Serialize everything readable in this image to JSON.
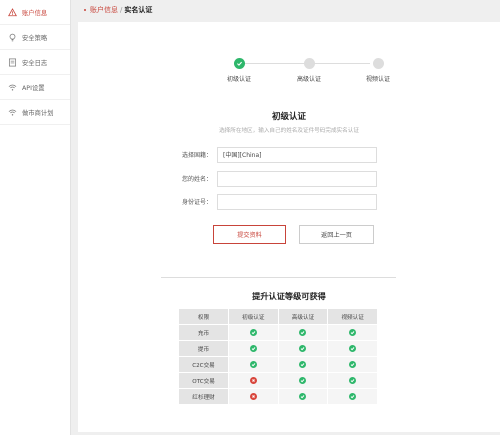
{
  "sidebar": {
    "items": [
      {
        "label": "账户信息",
        "icon": "warning-icon",
        "active": true
      },
      {
        "label": "安全策略",
        "icon": "bulb-icon",
        "active": false
      },
      {
        "label": "安全日志",
        "icon": "document-icon",
        "active": false
      },
      {
        "label": "API设置",
        "icon": "wifi-icon",
        "active": false
      },
      {
        "label": "做市商计划",
        "icon": "wifi-icon",
        "active": false
      }
    ]
  },
  "breadcrumb": {
    "parent": "账户信息",
    "separator": "/",
    "current": "实名认证"
  },
  "steps": [
    {
      "label": "初级认证",
      "done": true
    },
    {
      "label": "高级认证",
      "done": false
    },
    {
      "label": "视频认证",
      "done": false
    }
  ],
  "form": {
    "title": "初级认证",
    "subtitle": "选择所在地区，输入自己的姓名及证件号码完成实名认证",
    "fields": [
      {
        "label": "选择国籍：",
        "value": "[中国][China]"
      },
      {
        "label": "您的姓名：",
        "value": ""
      },
      {
        "label": "身份证号：",
        "value": ""
      }
    ],
    "submit_label": "提交资料",
    "back_label": "返回上一页"
  },
  "levels": {
    "title": "提升认证等级可获得",
    "headers": [
      "权限",
      "初级认证",
      "高级认证",
      "视频认证"
    ],
    "rows": [
      {
        "name": "充币",
        "values": [
          true,
          true,
          true
        ]
      },
      {
        "name": "提币",
        "values": [
          true,
          true,
          true
        ]
      },
      {
        "name": "C2C交易",
        "values": [
          true,
          true,
          true
        ]
      },
      {
        "name": "OTC交易",
        "values": [
          false,
          true,
          true
        ]
      },
      {
        "name": "红杉理财",
        "values": [
          false,
          true,
          true
        ]
      }
    ]
  },
  "colors": {
    "accent": "#c8443a",
    "success": "#2eb76b",
    "danger": "#d8453b"
  }
}
